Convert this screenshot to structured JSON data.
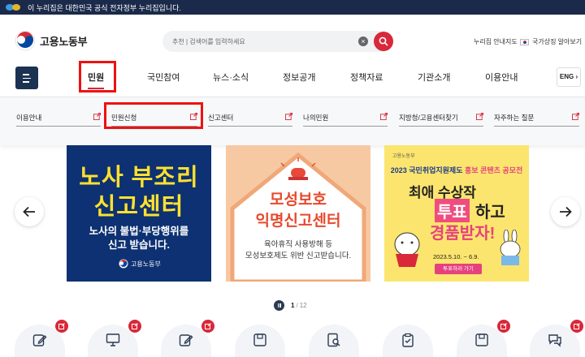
{
  "gov_banner": {
    "text": "이 누리집은 대한민국 공식 전자정부 누리집입니다."
  },
  "header": {
    "logo_text": "고용노동부",
    "search": {
      "placeholder": "추천 | 검색어를 입력하세요"
    },
    "util_links": [
      "누리집 안내지도",
      "국가상징 알아보기"
    ]
  },
  "nav": {
    "items": [
      "민원",
      "국민참여",
      "뉴스·소식",
      "정보공개",
      "정책자료",
      "기관소개",
      "이용안내"
    ],
    "active": "민원",
    "lang_button": "ENG"
  },
  "submenu": {
    "items": [
      "이용안내",
      "민원신청",
      "신고센터",
      "나의민원",
      "지방청/고용센터찾기",
      "자주하는 질문"
    ]
  },
  "carousel": {
    "slides": [
      {
        "title_lines": [
          "노사 부조리",
          "신고센터"
        ],
        "body_lines": [
          "노사의 불법·부당행위를",
          "신고 받습니다."
        ],
        "logo_text": "고용노동부"
      },
      {
        "title_lines": [
          "모성보호",
          "익명신고센터"
        ],
        "body_lines": [
          "육아휴직 사용방해 등",
          "모성보호제도 위반 신고받습니다."
        ]
      },
      {
        "top_text": "고용노동부",
        "title_prefix": "2023 국민취업지원제도",
        "title_highlight": "홍보 콘텐츠 공모전",
        "big_line1": "최애 수상작",
        "big_vote": "투표",
        "big_vote_suffix": "하고",
        "big_line3": "경품받자!",
        "date_text": "2023.5.10. ~ 6.9.",
        "button_label": "투표하러 가기"
      }
    ],
    "pager": {
      "current": "1",
      "total": "12"
    }
  },
  "quick_services_count": 8,
  "colors": {
    "banner": "#1b2a4a",
    "accent_red": "#d8283a",
    "highlight": "#ee1111",
    "navy": "#1b3253"
  }
}
